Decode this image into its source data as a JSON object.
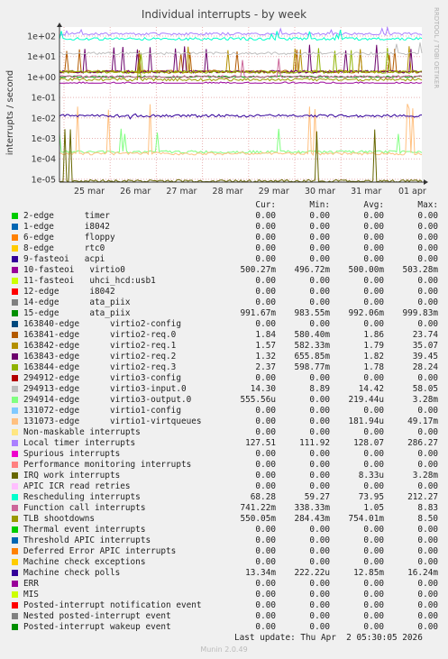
{
  "chart_data": {
    "type": "line",
    "title": "Individual interrupts - by week",
    "ylabel": "interrupts / second",
    "yscale": "log",
    "ylim": [
      5e-06,
      200
    ],
    "yticks": [
      "1e+02",
      "1e+01",
      "1e+00",
      "1e-01",
      "1e-02",
      "1e-03",
      "1e-04",
      "1e-05"
    ],
    "xticks": [
      "25 mar",
      "26 mar",
      "27 mar",
      "28 mar",
      "29 mar",
      "30 mar",
      "31 mar",
      "01 apr"
    ],
    "watermark": "RRDTOOL / TOBI OETIKER",
    "columns": [
      "Cur:",
      "Min:",
      "Avg:",
      "Max:"
    ],
    "series": [
      {
        "name": "2-edge      timer",
        "color": "#00cc00",
        "cur": "0.00",
        "min": "0.00",
        "avg": "0.00",
        "max": "0.00"
      },
      {
        "name": "1-edge      i8042",
        "color": "#0066b3",
        "cur": "0.00",
        "min": "0.00",
        "avg": "0.00",
        "max": "0.00"
      },
      {
        "name": "6-edge      floppy",
        "color": "#ff8000",
        "cur": "0.00",
        "min": "0.00",
        "avg": "0.00",
        "max": "0.00"
      },
      {
        "name": "8-edge      rtc0",
        "color": "#ffcc00",
        "cur": "0.00",
        "min": "0.00",
        "avg": "0.00",
        "max": "0.00"
      },
      {
        "name": "9-fasteoi   acpi",
        "color": "#330099",
        "cur": "0.00",
        "min": "0.00",
        "avg": "0.00",
        "max": "0.00"
      },
      {
        "name": "10-fasteoi   virtio0",
        "color": "#990099",
        "cur": "500.27m",
        "min": "496.72m",
        "avg": "500.00m",
        "max": "503.28m"
      },
      {
        "name": "11-fasteoi   uhci_hcd:usb1",
        "color": "#ccff00",
        "cur": "0.00",
        "min": "0.00",
        "avg": "0.00",
        "max": "0.00"
      },
      {
        "name": "12-edge      i8042",
        "color": "#ff0000",
        "cur": "0.00",
        "min": "0.00",
        "avg": "0.00",
        "max": "0.00"
      },
      {
        "name": "14-edge      ata_piix",
        "color": "#808080",
        "cur": "0.00",
        "min": "0.00",
        "avg": "0.00",
        "max": "0.00"
      },
      {
        "name": "15-edge      ata_piix",
        "color": "#008f00",
        "cur": "991.67m",
        "min": "983.55m",
        "avg": "992.06m",
        "max": "999.83m"
      },
      {
        "name": "163840-edge      virtio2-config",
        "color": "#00487d",
        "cur": "0.00",
        "min": "0.00",
        "avg": "0.00",
        "max": "0.00"
      },
      {
        "name": "163841-edge      virtio2-req.0",
        "color": "#b35a00",
        "cur": "1.84",
        "min": "580.40m",
        "avg": "1.86",
        "max": "23.74"
      },
      {
        "name": "163842-edge      virtio2-req.1",
        "color": "#b38f00",
        "cur": "1.57",
        "min": "582.33m",
        "avg": "1.79",
        "max": "35.07"
      },
      {
        "name": "163843-edge      virtio2-req.2",
        "color": "#6b006b",
        "cur": "1.32",
        "min": "655.85m",
        "avg": "1.82",
        "max": "39.45"
      },
      {
        "name": "163844-edge      virtio2-req.3",
        "color": "#8fb300",
        "cur": "2.37",
        "min": "598.77m",
        "avg": "1.78",
        "max": "28.24"
      },
      {
        "name": "294912-edge      virtio3-config",
        "color": "#b30000",
        "cur": "0.00",
        "min": "0.00",
        "avg": "0.00",
        "max": "0.00"
      },
      {
        "name": "294913-edge      virtio3-input.0",
        "color": "#bebebe",
        "cur": "14.30",
        "min": "8.89",
        "avg": "14.42",
        "max": "58.05"
      },
      {
        "name": "294914-edge      virtio3-output.0",
        "color": "#80ff80",
        "cur": "555.56u",
        "min": "0.00",
        "avg": "219.44u",
        "max": "3.28m"
      },
      {
        "name": "131072-edge      virtio1-config",
        "color": "#80c9ff",
        "cur": "0.00",
        "min": "0.00",
        "avg": "0.00",
        "max": "0.00"
      },
      {
        "name": "131073-edge      virtio1-virtqueues",
        "color": "#ffc080",
        "cur": "0.00",
        "min": "0.00",
        "avg": "181.94u",
        "max": "49.17m"
      },
      {
        "name": "Non-maskable interrupts",
        "color": "#ffe680",
        "cur": "0.00",
        "min": "0.00",
        "avg": "0.00",
        "max": "0.00"
      },
      {
        "name": "Local timer interrupts",
        "color": "#aa80ff",
        "cur": "127.51",
        "min": "111.92",
        "avg": "128.07",
        "max": "286.27"
      },
      {
        "name": "Spurious interrupts",
        "color": "#ee00cc",
        "cur": "0.00",
        "min": "0.00",
        "avg": "0.00",
        "max": "0.00"
      },
      {
        "name": "Performance monitoring interrupts",
        "color": "#ff8080",
        "cur": "0.00",
        "min": "0.00",
        "avg": "0.00",
        "max": "0.00"
      },
      {
        "name": "IRQ work interrupts",
        "color": "#666600",
        "cur": "0.00",
        "min": "0.00",
        "avg": "8.33u",
        "max": "3.28m"
      },
      {
        "name": "APIC ICR read retries",
        "color": "#ffbfff",
        "cur": "0.00",
        "min": "0.00",
        "avg": "0.00",
        "max": "0.00"
      },
      {
        "name": "Rescheduling interrupts",
        "color": "#00ffcc",
        "cur": "68.28",
        "min": "59.27",
        "avg": "73.95",
        "max": "212.27"
      },
      {
        "name": "Function call interrupts",
        "color": "#cc6699",
        "cur": "741.22m",
        "min": "338.33m",
        "avg": "1.05",
        "max": "8.83"
      },
      {
        "name": "TLB shootdowns",
        "color": "#999900",
        "cur": "550.05m",
        "min": "284.43m",
        "avg": "754.01m",
        "max": "8.50"
      },
      {
        "name": "Thermal event interrupts",
        "color": "#00cc00",
        "cur": "0.00",
        "min": "0.00",
        "avg": "0.00",
        "max": "0.00"
      },
      {
        "name": "Threshold APIC interrupts",
        "color": "#0066b3",
        "cur": "0.00",
        "min": "0.00",
        "avg": "0.00",
        "max": "0.00"
      },
      {
        "name": "Deferred Error APIC interrupts",
        "color": "#ff8000",
        "cur": "0.00",
        "min": "0.00",
        "avg": "0.00",
        "max": "0.00"
      },
      {
        "name": "Machine check exceptions",
        "color": "#ffcc00",
        "cur": "0.00",
        "min": "0.00",
        "avg": "0.00",
        "max": "0.00"
      },
      {
        "name": "Machine check polls",
        "color": "#330099",
        "cur": "13.34m",
        "min": "222.22u",
        "avg": "12.85m",
        "max": "16.24m"
      },
      {
        "name": "ERR",
        "color": "#990099",
        "cur": "0.00",
        "min": "0.00",
        "avg": "0.00",
        "max": "0.00"
      },
      {
        "name": "MIS",
        "color": "#ccff00",
        "cur": "0.00",
        "min": "0.00",
        "avg": "0.00",
        "max": "0.00"
      },
      {
        "name": "Posted-interrupt notification event",
        "color": "#ff0000",
        "cur": "0.00",
        "min": "0.00",
        "avg": "0.00",
        "max": "0.00"
      },
      {
        "name": "Nested posted-interrupt event",
        "color": "#808080",
        "cur": "0.00",
        "min": "0.00",
        "avg": "0.00",
        "max": "0.00"
      },
      {
        "name": "Posted-interrupt wakeup event",
        "color": "#008f00",
        "cur": "0.00",
        "min": "0.00",
        "avg": "0.00",
        "max": "0.00"
      }
    ]
  },
  "last_update": "Last update: Thu Apr  2 05:30:05 2026",
  "footer": "Munin 2.0.49"
}
